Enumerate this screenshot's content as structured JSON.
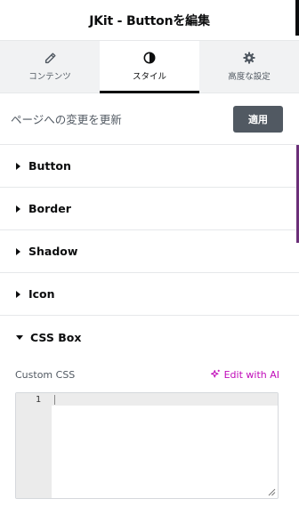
{
  "header": {
    "title": "JKit - Buttonを編集"
  },
  "tabs": [
    {
      "label": "コンテンツ",
      "icon": "pencil-icon",
      "active": false
    },
    {
      "label": "スタイル",
      "icon": "contrast-icon",
      "active": true
    },
    {
      "label": "高度な設定",
      "icon": "gear-icon",
      "active": false
    }
  ],
  "apply": {
    "text": "ページへの変更を更新",
    "button_label": "適用"
  },
  "sections": [
    {
      "name": "Button",
      "open": false
    },
    {
      "name": "Border",
      "open": false
    },
    {
      "name": "Shadow",
      "open": false
    },
    {
      "name": "Icon",
      "open": false
    },
    {
      "name": "CSS Box",
      "open": true
    }
  ],
  "css": {
    "label": "Custom CSS",
    "ai_label": "Edit with AI",
    "line_number": "1"
  },
  "colors": {
    "accent": "#c00bb9",
    "apply_button": "#515962",
    "scroll_accent": "#6b2f78"
  }
}
